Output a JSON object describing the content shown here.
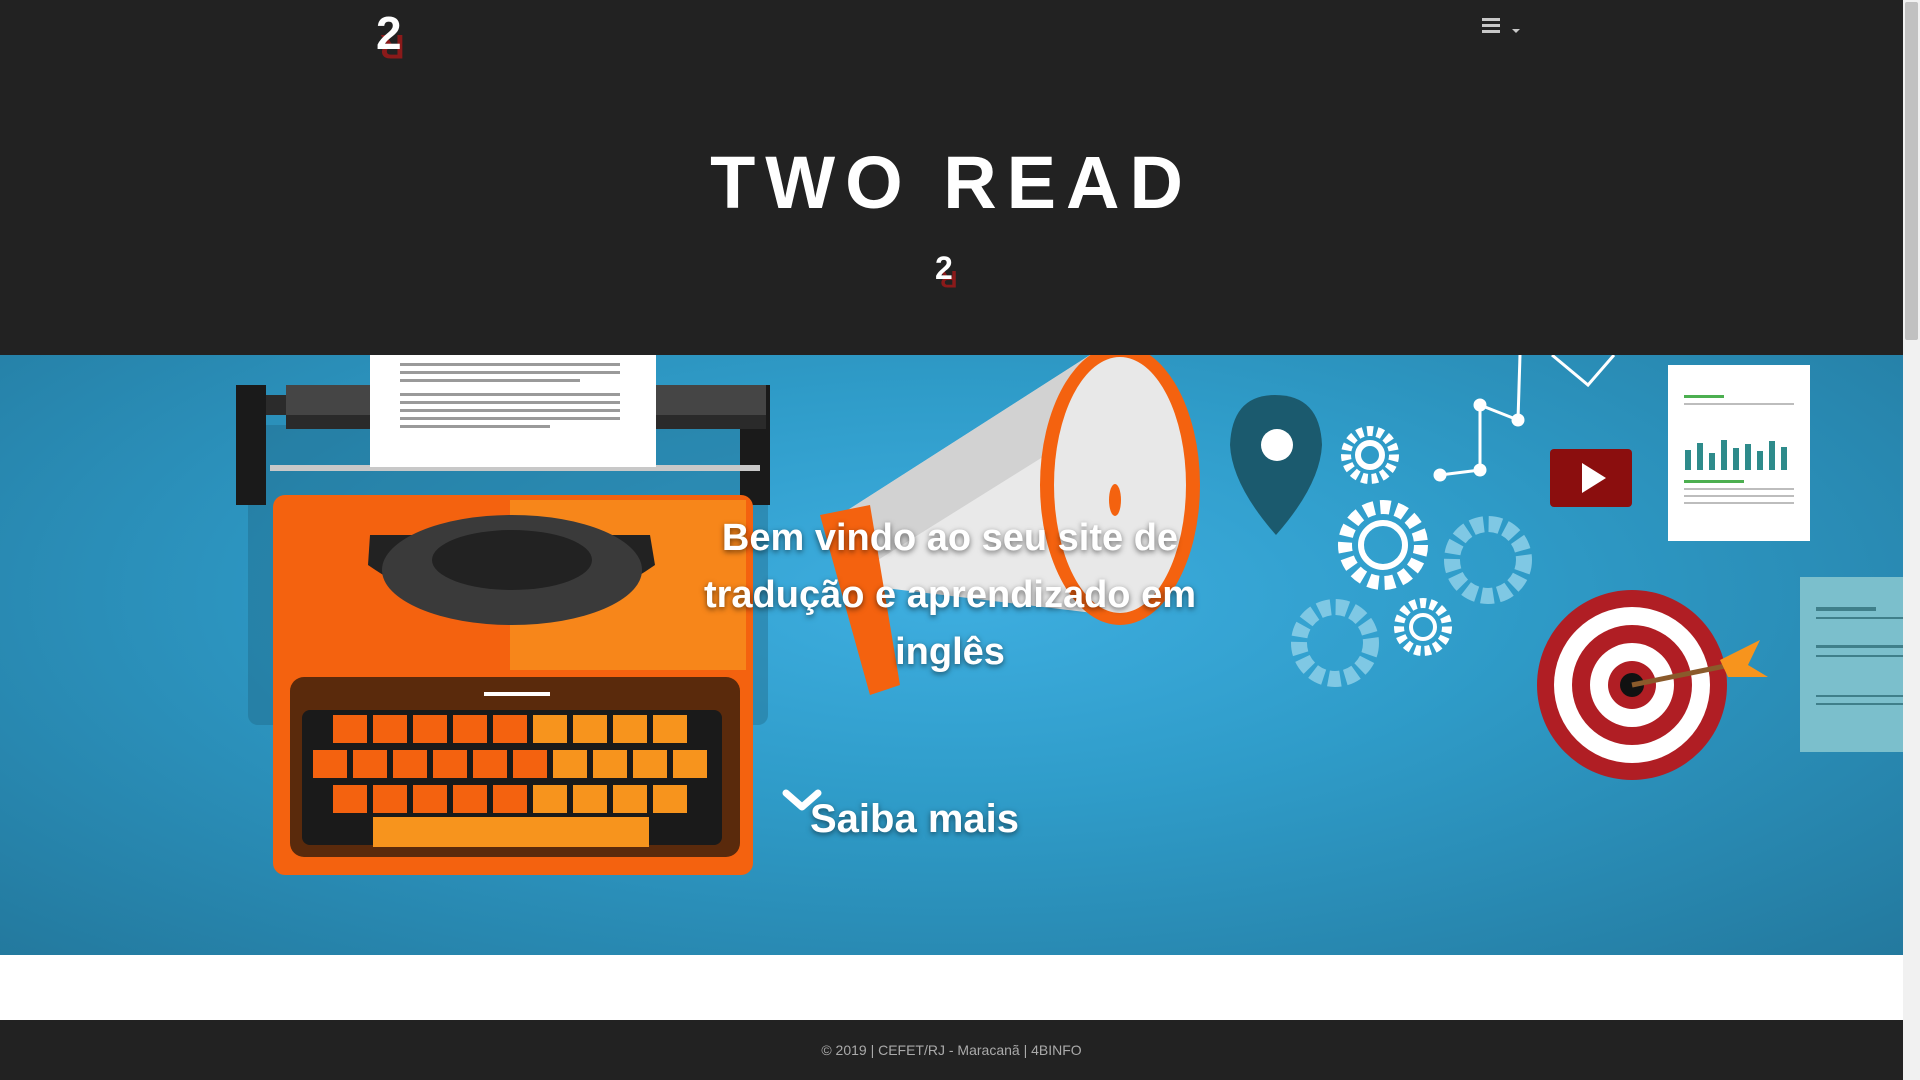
{
  "header": {
    "logo_digit": "2",
    "logo_accent": "R",
    "title": "TWO READ",
    "menu_icon": "hamburger-icon"
  },
  "hero": {
    "welcome_text": "Bem vindo ao seu site de tradução e aprendizado em inglês",
    "cta_label": "Saiba mais",
    "cta_icon": "chevron-down-icon"
  },
  "footer": {
    "copyright": "© 2019 | CEFET/RJ - Maracanã | 4BINFO"
  },
  "colors": {
    "dark": "#222222",
    "hero_blue": "#2f9cc9",
    "accent_red": "#8b1a1a",
    "orange": "#f4620f"
  }
}
